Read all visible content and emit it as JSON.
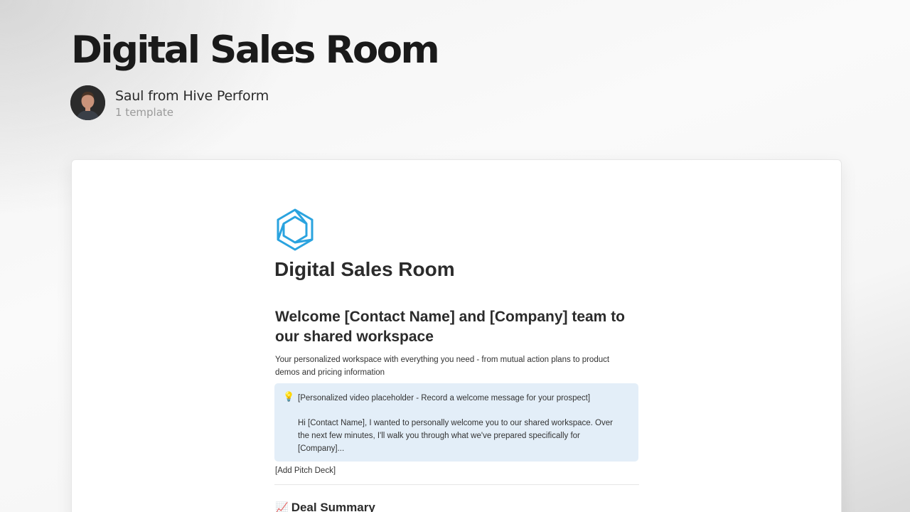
{
  "header": {
    "title": "Digital Sales Room",
    "author_name": "Saul from Hive Perform",
    "template_count": "1 template",
    "avatar_icon": "person-avatar"
  },
  "preview": {
    "logo_icon": "hexagon-logo-icon",
    "logo_color": "#2aa3df",
    "doc_title": "Digital Sales Room",
    "welcome_heading": "Welcome [Contact Name] and [Company] team to our shared workspace",
    "intro_text": "Your personalized workspace with everything you need - from mutual action plans to product demos and pricing information",
    "callout": {
      "icon": "lightbulb-icon",
      "glyph": "💡",
      "background": "#e3eef8",
      "line1": "[Personalized video placeholder - Record a welcome message for your prospect]",
      "line2": "Hi [Contact Name], I wanted to personally welcome you to our shared workspace. Over the next few minutes, I'll walk you through what we've prepared specifically for [Company]..."
    },
    "pitch_deck": "[Add Pitch Deck]",
    "deal_summary": {
      "emoji": "📈",
      "label": "Deal Summary"
    }
  }
}
